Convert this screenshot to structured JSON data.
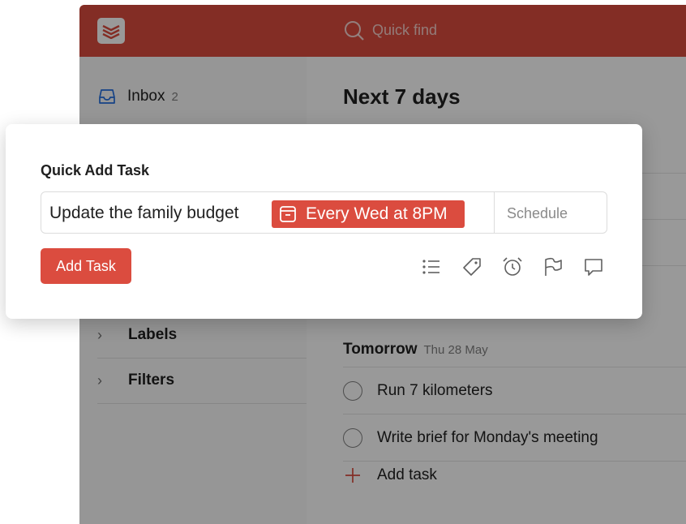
{
  "header": {
    "search_placeholder": "Quick find",
    "brand_color": "#db4c3f"
  },
  "sidebar": {
    "inbox": {
      "label": "Inbox",
      "count": "2"
    },
    "sections": [
      {
        "label": "Labels"
      },
      {
        "label": "Filters"
      }
    ]
  },
  "main": {
    "title": "Next 7 days",
    "day": {
      "label": "Tomorrow",
      "date": "Thu 28 May"
    },
    "tasks": [
      {
        "label": "Run 7 kilometers"
      },
      {
        "label": "Write brief for Monday's meeting"
      }
    ],
    "add_task_label": "Add task"
  },
  "dialog": {
    "title": "Quick Add Task",
    "task_text": "Update the family budget",
    "date_chip": "Every Wed at 8PM",
    "schedule_label": "Schedule",
    "add_button": "Add Task",
    "tools": [
      "project-list-icon",
      "label-tag-icon",
      "reminder-alarm-icon",
      "priority-flag-icon",
      "comment-icon"
    ]
  }
}
